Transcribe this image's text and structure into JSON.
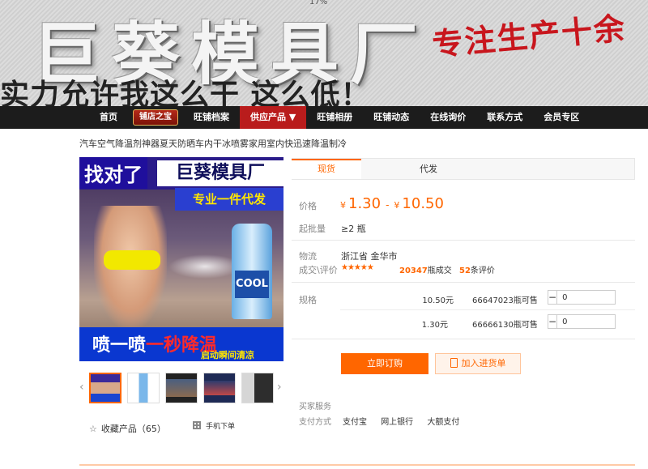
{
  "banner": {
    "title": "巨葵模具厂",
    "slogan": "实力允许我这么干 这么低！",
    "red_text": "专注生产十余",
    "percent": "17%"
  },
  "nav": {
    "items": [
      "首页",
      "旺铺档案",
      "供应产品 ▼",
      "旺铺相册",
      "旺铺动态",
      "在线询价",
      "联系方式",
      "会员专区"
    ],
    "badge": "铺店之宝",
    "active_index": 2
  },
  "product": {
    "title": "汽车空气降温剂神器夏天防晒车内干冰喷雾家用室内快迅速降温制冷",
    "image_text": {
      "top_a": "找对了",
      "top_b": "巨葵模具厂",
      "bar2": "专业一件代发",
      "can": "COOL",
      "bottom_a": "喷一喷",
      "bottom_b": "一秒降温",
      "bottom_small": "启动瞬间清凉"
    },
    "favorite": "收藏产品（65）",
    "mobile_order": "手机下单"
  },
  "tabs": [
    "现货",
    "代发"
  ],
  "pricing": {
    "price_label": "价格",
    "currency": "¥",
    "price_min": "1.30",
    "price_max": "10.50",
    "moq_label": "起批量",
    "moq": "≥2 瓶",
    "logistics_label": "物流",
    "logistics": "浙江省 金华市",
    "reviews_label": "成交\\评价",
    "stars": "★★★★★",
    "trade_count": "20347",
    "trade_suffix": "瓶成交",
    "review_count": "52",
    "review_suffix": "条评价"
  },
  "sku": {
    "label": "规格",
    "rows": [
      {
        "price": "10.50元",
        "stock": "66647023瓶可售",
        "qty": "0"
      },
      {
        "price": "1.30元",
        "stock": "66666130瓶可售",
        "qty": "0"
      }
    ],
    "minus": "−",
    "plus": "+"
  },
  "actions": {
    "buy": "立即订购",
    "cart": "加入进货单"
  },
  "service": {
    "service_label": "买家服务",
    "pay_label": "支付方式",
    "pay_methods": [
      "支付宝",
      "网上银行",
      "大额支付"
    ]
  },
  "colors": {
    "accent": "#ff6600",
    "nav_bg": "#1c1c1c",
    "nav_active": "#b91c1c"
  }
}
